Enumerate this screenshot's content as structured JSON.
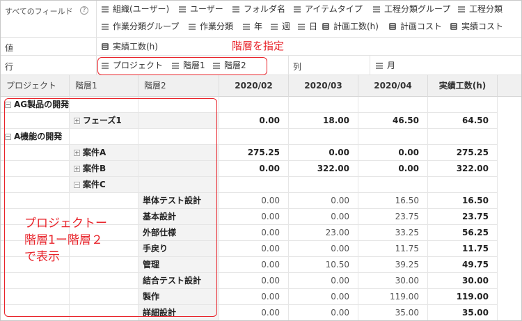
{
  "field_list": {
    "label": "すべてのフィールド",
    "help": "?",
    "fields": [
      "組織(ユーザー)",
      "ユーザー",
      "フォルダ名",
      "アイテムタイプ",
      "工程分類グループ",
      "工程分類",
      "作業分類グループ",
      "作業分類",
      "年",
      "週",
      "日",
      "計画工数(h)",
      "計画コスト",
      "実績コスト"
    ]
  },
  "values_area": {
    "label": "値",
    "fields": [
      "実績工数(h)"
    ]
  },
  "rows_area": {
    "label": "行",
    "fields": [
      "プロジェクト",
      "階層1",
      "階層2"
    ]
  },
  "columns_area": {
    "label": "列",
    "fields": [
      "月"
    ]
  },
  "annotations": {
    "top": "階層を指定",
    "side": [
      "プロジェクトー",
      "階層1ー階層２",
      "で表示"
    ]
  },
  "grid": {
    "row_headers": [
      "プロジェクト",
      "階層1",
      "階層2"
    ],
    "columns": [
      "2020/02",
      "2020/03",
      "2020/04",
      "実績工数(h)"
    ],
    "rows": [
      {
        "project": "AG製品の開発",
        "l1": "",
        "l2": "",
        "values": [
          "",
          "",
          "",
          ""
        ]
      },
      {
        "project": "",
        "l1": "フェーズ1",
        "l2": "",
        "values": [
          "0.00",
          "18.00",
          "46.50",
          "64.50"
        ]
      },
      {
        "project": "A機能の開発",
        "l1": "",
        "l2": "",
        "values": [
          "",
          "",
          "",
          ""
        ]
      },
      {
        "project": "",
        "l1": "案件A",
        "l2": "",
        "values": [
          "275.25",
          "0.00",
          "0.00",
          "275.25"
        ]
      },
      {
        "project": "",
        "l1": "案件B",
        "l2": "",
        "values": [
          "0.00",
          "322.00",
          "0.00",
          "322.00"
        ]
      },
      {
        "project": "",
        "l1": "案件C",
        "l2": "",
        "values": [
          "",
          "",
          "",
          ""
        ]
      },
      {
        "project": "",
        "l1": "",
        "l2": "単体テスト設計",
        "values": [
          "0.00",
          "0.00",
          "16.50",
          "16.50"
        ]
      },
      {
        "project": "",
        "l1": "",
        "l2": "基本設計",
        "values": [
          "0.00",
          "0.00",
          "23.75",
          "23.75"
        ]
      },
      {
        "project": "",
        "l1": "",
        "l2": "外部仕様",
        "values": [
          "0.00",
          "23.00",
          "33.25",
          "56.25"
        ]
      },
      {
        "project": "",
        "l1": "",
        "l2": "手戻り",
        "values": [
          "0.00",
          "0.00",
          "11.75",
          "11.75"
        ]
      },
      {
        "project": "",
        "l1": "",
        "l2": "管理",
        "values": [
          "0.00",
          "10.50",
          "39.25",
          "49.75"
        ]
      },
      {
        "project": "",
        "l1": "",
        "l2": "結合テスト設計",
        "values": [
          "0.00",
          "0.00",
          "30.00",
          "30.00"
        ]
      },
      {
        "project": "",
        "l1": "",
        "l2": "製作",
        "values": [
          "0.00",
          "0.00",
          "119.00",
          "119.00"
        ]
      },
      {
        "project": "",
        "l1": "",
        "l2": "詳細設計",
        "values": [
          "0.00",
          "0.00",
          "35.00",
          "35.00"
        ]
      }
    ]
  },
  "colors": {
    "annotation": "#e8232a",
    "header_bg": "#f0f0f0",
    "subtotal_bg": "#f3f3f3"
  }
}
